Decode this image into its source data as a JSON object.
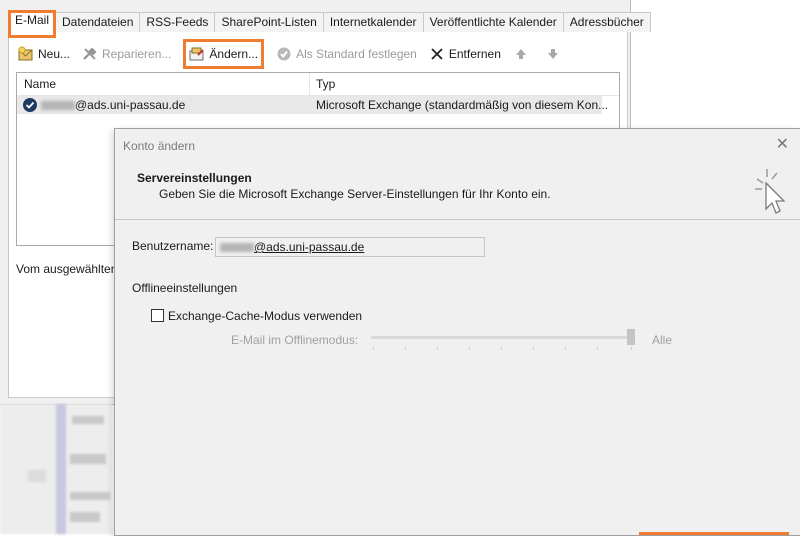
{
  "background_window": {
    "tabs": [
      {
        "label": "E-Mail",
        "active": true
      },
      {
        "label": "Datendateien",
        "active": false
      },
      {
        "label": "RSS-Feeds",
        "active": false
      },
      {
        "label": "SharePoint-Listen",
        "active": false
      },
      {
        "label": "Internetkalender",
        "active": false
      },
      {
        "label": "Veröffentlichte Kalender",
        "active": false
      },
      {
        "label": "Adressbücher",
        "active": false
      }
    ],
    "toolbar": {
      "new_label": "Neu...",
      "repair_label": "Reparieren...",
      "change_label": "Ändern...",
      "default_label": "Als Standard festlegen",
      "remove_label": "Entfernen"
    },
    "list": {
      "col_name": "Name",
      "col_type": "Typ",
      "rows": [
        {
          "name_suffix": "@ads.uni-passau.de",
          "type": "Microsoft Exchange (standardmäßig von diesem Kon..."
        }
      ]
    },
    "selected_text": "Vom ausgewählten"
  },
  "dialog": {
    "title": "Konto ändern",
    "close_glyph": "✕",
    "header_title": "Servereinstellungen",
    "header_subtitle": "Geben Sie die Microsoft Exchange Server-Einstellungen für Ihr Konto ein.",
    "username_label": "Benutzername:",
    "username_suffix": "@ads.uni-passau.de",
    "offline_section": "Offlineeinstellungen",
    "cache_mode_label": "Exchange-Cache-Modus verwenden",
    "cache_mode_checked": false,
    "offline_mail_label": "E-Mail im Offlinemodus:",
    "offline_mail_value": "Alle"
  },
  "colors": {
    "highlight": "#ee7d31",
    "account_icon": "#1f3b62"
  }
}
